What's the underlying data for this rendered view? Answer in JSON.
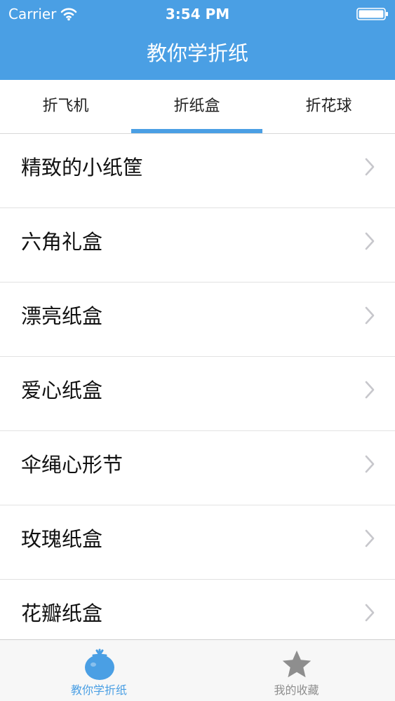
{
  "status_bar": {
    "carrier": "Carrier",
    "time": "3:54 PM",
    "wifi_icon": "wifi-icon",
    "battery_icon": "battery-icon"
  },
  "nav": {
    "title": "教你学折纸"
  },
  "tabs": [
    {
      "label": "折飞机",
      "selected": false
    },
    {
      "label": "折纸盒",
      "selected": true
    },
    {
      "label": "折花球",
      "selected": false
    }
  ],
  "list": {
    "items": [
      {
        "label": "精致的小纸筐"
      },
      {
        "label": "六角礼盒"
      },
      {
        "label": "漂亮纸盒"
      },
      {
        "label": "爱心纸盒"
      },
      {
        "label": "伞绳心形节"
      },
      {
        "label": "玫瑰纸盒"
      },
      {
        "label": "花瓣纸盒"
      }
    ],
    "chevron_icon": "chevron-right-icon"
  },
  "tab_bar": {
    "items": [
      {
        "label": "教你学折纸",
        "icon": "tomato-icon",
        "selected": true
      },
      {
        "label": "我的收藏",
        "icon": "star-icon",
        "selected": false
      }
    ]
  },
  "colors": {
    "accent": "#4a9fe4",
    "inactive": "#8e8e8e",
    "separator": "#e2e2e2",
    "tab_bar_bg": "#f7f7f7"
  }
}
